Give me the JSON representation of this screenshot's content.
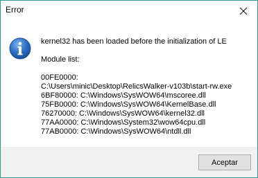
{
  "window": {
    "title": "Error"
  },
  "dialog": {
    "icon": "info-icon",
    "message_line": "kernel32 has been loaded before the initialization of LE",
    "module_list_label": "Module list:",
    "modules": [
      "00FE0000:",
      "C:\\Users\\minic\\Desktop\\RelicsWalker-v103b\\start-rw.exe",
      "6BF80000: C:\\Windows\\SysWOW64\\mscoree.dll",
      "75FB0000: C:\\Windows\\SysWOW64\\KernelBase.dll",
      "76270000: C:\\Windows\\SysWOW64\\kernel32.dll",
      "77AA0000: C:\\Windows\\System32\\wow64cpu.dll",
      "77AB0000: C:\\Windows\\SysWOW64\\ntdll.dll"
    ]
  },
  "footer": {
    "accept_label": "Aceptar"
  },
  "colors": {
    "border": "#2f9a8c",
    "footer_bg": "#f0f0f0",
    "button_bg": "#e1e1e1",
    "button_border": "#adadad",
    "icon_blue": "#2d6fc2"
  }
}
